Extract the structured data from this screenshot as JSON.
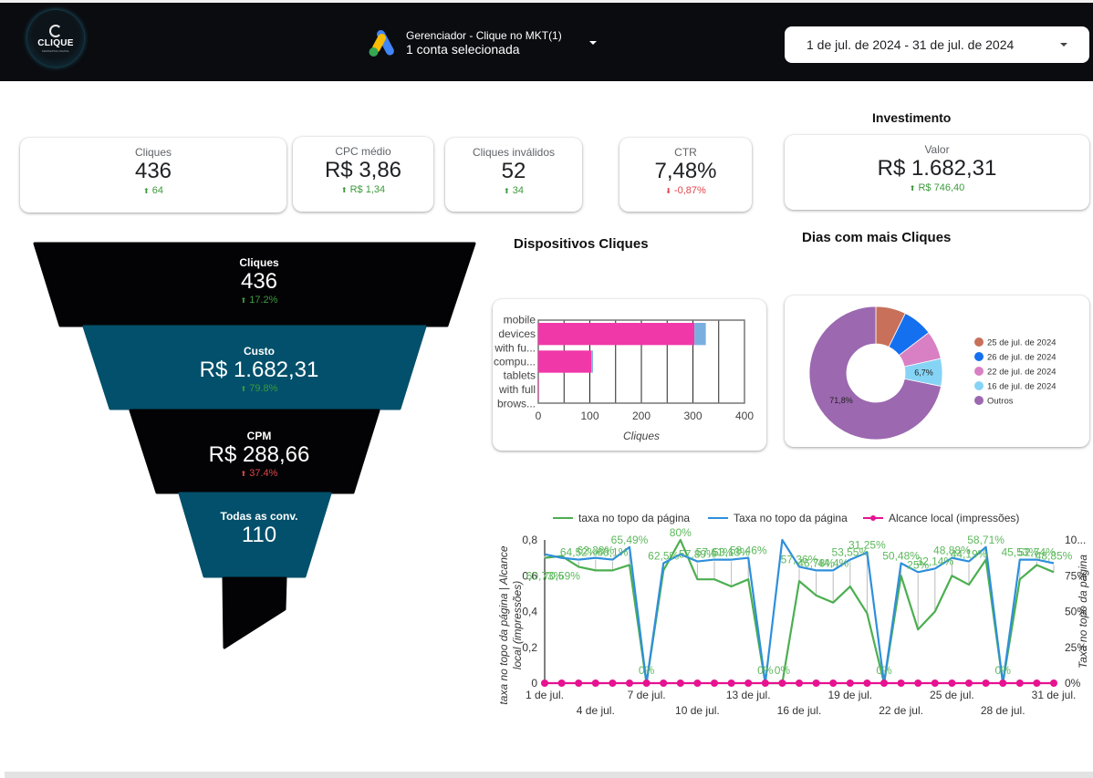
{
  "header": {
    "logo_text": "CLIQUE",
    "logo_subtext": "MARKETING DIGITAL",
    "account_selector": {
      "title": "Gerenciador - Clique no MKT(1)",
      "subtitle": "1 conta selecionada",
      "icon": "google-ads-icon"
    },
    "date_range": "1 de jul. de 2024 - 31 de jul. de 2024"
  },
  "kpis": [
    {
      "label": "Cliques",
      "value": "436",
      "delta": "64",
      "trend": "up"
    },
    {
      "label": "CPC médio",
      "value": "R$ 3,86",
      "delta": "R$ 1,34",
      "trend": "up"
    },
    {
      "label": "Cliques inválidos",
      "value": "52",
      "delta": "34",
      "trend": "up"
    },
    {
      "label": "CTR",
      "value": "7,48%",
      "delta": "-0,87%",
      "trend": "down"
    }
  ],
  "investimento": {
    "title": "Investimento",
    "label": "Valor",
    "value": "R$ 1.682,31",
    "delta": "R$ 746,40",
    "trend": "up"
  },
  "funnel": [
    {
      "label": "Cliques",
      "value": "436",
      "delta": "17.2%",
      "trend": "up",
      "color": "#030305"
    },
    {
      "label": "Custo",
      "value": "R$ 1.682,31",
      "delta": "79.8%",
      "trend": "up",
      "color": "#02506b"
    },
    {
      "label": "CPM",
      "value": "R$ 288,66",
      "delta": "37.4%",
      "trend": "up-negative",
      "color": "#030305"
    },
    {
      "label": "Todas as conv.",
      "value": "110",
      "delta": "",
      "trend": "",
      "color": "#02506b"
    }
  ],
  "colors": {
    "positive": "#3c9a3c",
    "negative": "#e0454a",
    "header_bg": "#0b0c10",
    "funnel_dark": "#030305",
    "funnel_teal": "#02506b"
  },
  "devices_title": "Dispositivos Cliques",
  "days_title": "Dias com mais Cliques",
  "chart_data": [
    {
      "type": "bar",
      "orientation": "horizontal",
      "stacked": true,
      "title": "Dispositivos Cliques",
      "categories": [
        "mobile devices with fu...",
        "compu...",
        "tablets with full brows..."
      ],
      "category_lines": [
        [
          "mobile",
          "devices",
          "with fu..."
        ],
        [
          "compu..."
        ],
        [
          "tablets",
          "with full",
          "brows..."
        ]
      ],
      "series": [
        {
          "name": "Cliques",
          "color": "#f038a8",
          "values": [
            303,
            103,
            1
          ]
        },
        {
          "name": "Cliques inválidos",
          "color": "#7aaedf",
          "values": [
            22,
            3,
            0
          ]
        }
      ],
      "xlabel": "Cliques",
      "xlim": [
        0,
        400
      ],
      "xticks": [
        "0",
        "100",
        "200",
        "300",
        "400"
      ],
      "grid": true
    },
    {
      "type": "pie",
      "donut": true,
      "title": "Dias com mais Cliques",
      "labels": [
        "25 de jul. de 2024",
        "26 de jul. de 2024",
        "22 de jul. de 2024",
        "16 de jul. de 2024",
        "Outros"
      ],
      "values": [
        7.3,
        7.3,
        6.9,
        6.7,
        71.8
      ],
      "colors": [
        "#c8705a",
        "#1570ef",
        "#d980c4",
        "#86d4f5",
        "#9c68b0"
      ],
      "visible_labels": [
        "",
        "",
        "",
        "6,7%",
        "71,8%"
      ],
      "legend": "right"
    },
    {
      "type": "line",
      "x": [
        "1 de jul.",
        "2 de jul.",
        "3 de jul.",
        "4 de jul.",
        "5 de jul.",
        "6 de jul.",
        "7 de jul.",
        "8 de jul.",
        "9 de jul.",
        "10 de jul.",
        "11 de jul.",
        "12 de jul.",
        "13 de jul.",
        "14 de jul.",
        "15 de jul.",
        "16 de jul.",
        "17 de jul.",
        "18 de jul.",
        "19 de jul.",
        "20 de jul.",
        "21 de jul.",
        "22 de jul.",
        "23 de jul.",
        "24 de jul.",
        "25 de jul.",
        "26 de jul.",
        "27 de jul.",
        "28 de jul.",
        "29 de jul.",
        "30 de jul.",
        "31 de jul."
      ],
      "xticks_row1": [
        "1 de jul.",
        "7 de jul.",
        "13 de jul.",
        "19 de jul.",
        "25 de jul.",
        "31 de jul."
      ],
      "xticks_row2": [
        "4 de jul.",
        "10 de jul.",
        "16 de jul.",
        "22 de jul.",
        "28 de jul."
      ],
      "series": [
        {
          "name": "taxa no topo da página",
          "color": "#4caf50",
          "axis": "left",
          "values": [
            0.7,
            0.71,
            0.65,
            0.63,
            0.63,
            0.66,
            0,
            0.63,
            0.8,
            0.58,
            0.58,
            0.54,
            0.58,
            0,
            0,
            0.57,
            0.49,
            0.45,
            0.54,
            0.39,
            0,
            0.6,
            0.3,
            0.4,
            0.6,
            0.55,
            0.69,
            0,
            0.58,
            0.66,
            0.62
          ]
        },
        {
          "name": "Taxa no topo da página",
          "color": "#2f8fdb",
          "axis": "right",
          "values": [
            0.72,
            0.7,
            0.69,
            0.7,
            0.69,
            0.76,
            0,
            0.67,
            0.72,
            0.68,
            0.69,
            0.69,
            0.7,
            0,
            0.8,
            0.65,
            0.63,
            0.63,
            0.69,
            0.73,
            0,
            0.67,
            0.62,
            0.64,
            0.7,
            0.68,
            0.76,
            0,
            0.69,
            0.69,
            0.67
          ]
        },
        {
          "name": "Alcance local (impressões)",
          "color": "#e6128f",
          "axis": "left",
          "markers": true,
          "values": [
            0,
            0,
            0,
            0,
            0,
            0,
            0,
            0,
            0,
            0,
            0,
            0,
            0,
            0,
            0,
            0,
            0,
            0,
            0,
            0,
            0,
            0,
            0,
            0,
            0,
            0,
            0,
            0,
            0,
            0,
            0
          ]
        }
      ],
      "data_labels": [
        {
          "day": 1,
          "text": "60,73%"
        },
        {
          "day": 2,
          "text": "70,59%"
        },
        {
          "day": 3,
          "text": "64,52%"
        },
        {
          "day": 4,
          "text": "62,38%"
        },
        {
          "day": 5,
          "text": "68,1%"
        },
        {
          "day": 6,
          "text": "65,49%"
        },
        {
          "day": 7,
          "text": "0%"
        },
        {
          "day": 8,
          "text": "62,5%"
        },
        {
          "day": 9,
          "text": "80%"
        },
        {
          "day": 10,
          "text": "57,89%"
        },
        {
          "day": 11,
          "text": "57,61%"
        },
        {
          "day": 12,
          "text": "53,13%"
        },
        {
          "day": 13,
          "text": "58,46%"
        },
        {
          "day": 14,
          "text": "0%"
        },
        {
          "day": 15,
          "text": "0%"
        },
        {
          "day": 16,
          "text": "57,36%"
        },
        {
          "day": 17,
          "text": "46,78%"
        },
        {
          "day": 18,
          "text": "44,4%"
        },
        {
          "day": 19,
          "text": "53,55%"
        },
        {
          "day": 20,
          "text": "31,25%"
        },
        {
          "day": 21,
          "text": "0%"
        },
        {
          "day": 22,
          "text": "50,48%"
        },
        {
          "day": 23,
          "text": "25%"
        },
        {
          "day": 24,
          "text": "32,14%"
        },
        {
          "day": 25,
          "text": "48,88%"
        },
        {
          "day": 26,
          "text": "44,19%"
        },
        {
          "day": 27,
          "text": "58,71%"
        },
        {
          "day": 28,
          "text": "0%"
        },
        {
          "day": 29,
          "text": "45,53%"
        },
        {
          "day": 30,
          "text": "52,74%"
        },
        {
          "day": 31,
          "text": "48,85%"
        }
      ],
      "left_axis": {
        "label": "taxa no topo da página | Alcance local (impressões)",
        "ticks": [
          "0",
          "0,2",
          "0,4",
          "0,6",
          "0,8"
        ],
        "range": [
          0,
          0.8
        ]
      },
      "right_axis": {
        "label": "Taxa no topo da página",
        "ticks": [
          "0%",
          "25%",
          "50%",
          "75%",
          "10..."
        ]
      },
      "legend": "top"
    }
  ]
}
